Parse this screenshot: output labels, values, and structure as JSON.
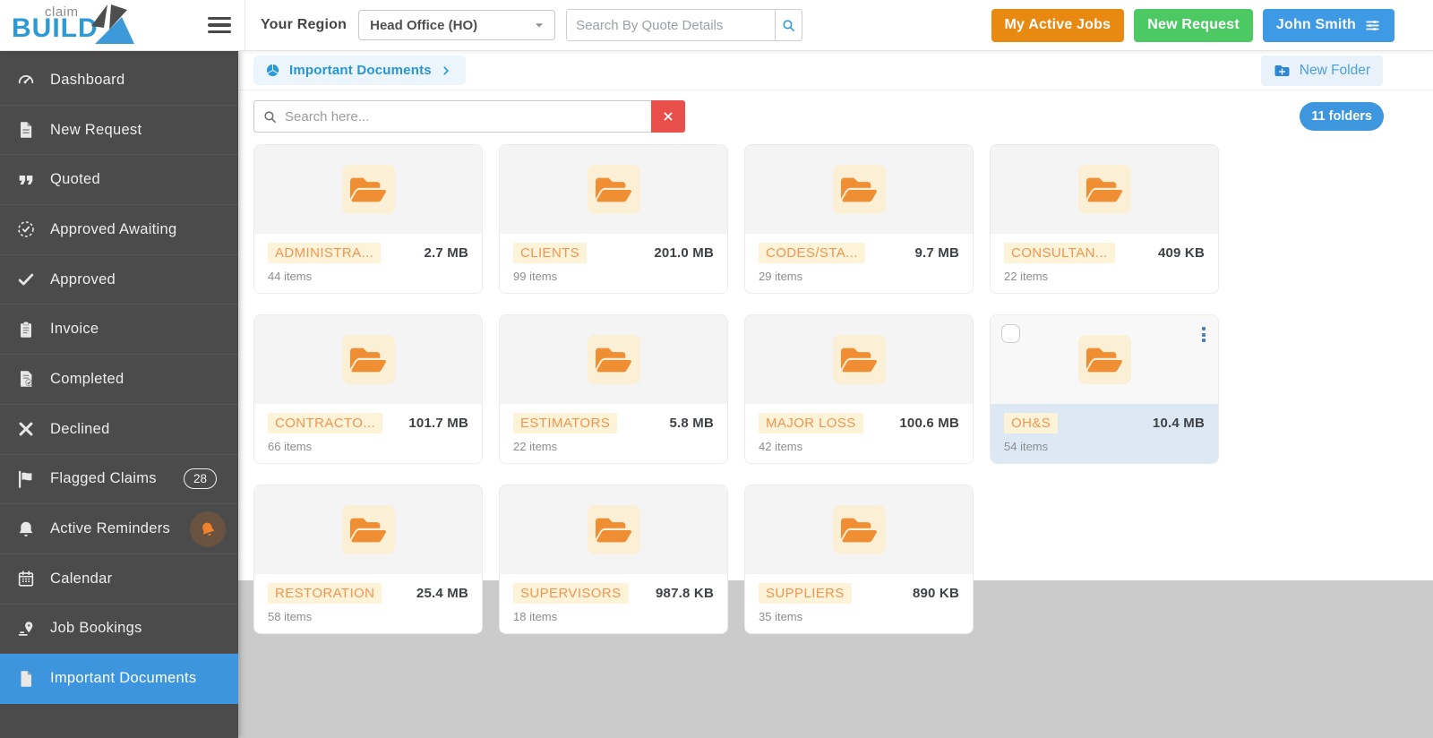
{
  "topbar": {
    "logo_line1": "claim",
    "logo_line2": "BUILD",
    "region_label": "Your Region",
    "region_value": "Head Office (HO)",
    "search_placeholder": "Search By Quote Details",
    "active_jobs_label": "My Active Jobs",
    "new_request_label": "New Request",
    "user_label": "John Smith"
  },
  "sidebar": {
    "items": [
      {
        "label": "Dashboard",
        "icon": "gauge"
      },
      {
        "label": "New Request",
        "icon": "file"
      },
      {
        "label": "Quoted",
        "icon": "quote"
      },
      {
        "label": "Approved Awaiting",
        "icon": "check-circle"
      },
      {
        "label": "Approved",
        "icon": "check"
      },
      {
        "label": "Invoice",
        "icon": "clipboard"
      },
      {
        "label": "Completed",
        "icon": "file-check"
      },
      {
        "label": "Declined",
        "icon": "x"
      },
      {
        "label": "Flagged Claims",
        "icon": "flag",
        "badge": "28"
      },
      {
        "label": "Active Reminders",
        "icon": "bell",
        "indicator": true
      },
      {
        "label": "Calendar",
        "icon": "calendar"
      },
      {
        "label": "Job Bookings",
        "icon": "map-pin"
      },
      {
        "label": "Important Documents",
        "icon": "document",
        "active": true
      }
    ]
  },
  "content": {
    "breadcrumb": "Important Documents",
    "new_folder_label": "New Folder",
    "search_placeholder": "Search here...",
    "folders_count_badge": "11 folders",
    "folders": [
      {
        "name": "ADMINISTRA...",
        "size": "2.7 MB",
        "items": "44 items"
      },
      {
        "name": "CLIENTS",
        "size": "201.0 MB",
        "items": "99 items"
      },
      {
        "name": "CODES/STA...",
        "size": "9.7 MB",
        "items": "29 items"
      },
      {
        "name": "CONSULTAN...",
        "size": "409 KB",
        "items": "22 items"
      },
      {
        "name": "CONTRACTO...",
        "size": "101.7 MB",
        "items": "66 items"
      },
      {
        "name": "ESTIMATORS",
        "size": "5.8 MB",
        "items": "22 items"
      },
      {
        "name": "MAJOR LOSS",
        "size": "100.6 MB",
        "items": "42 items"
      },
      {
        "name": "OH&S",
        "size": "10.4 MB",
        "items": "54 items",
        "selected": true
      },
      {
        "name": "RESTORATION",
        "size": "25.4 MB",
        "items": "58 items"
      },
      {
        "name": "SUPERVISORS",
        "size": "987.8 KB",
        "items": "18 items"
      },
      {
        "name": "SUPPLIERS",
        "size": "890 KB",
        "items": "35 items"
      }
    ]
  },
  "colors": {
    "accent_blue": "#3D96DE",
    "brand_blue": "#2D9AD8",
    "orange": "#E88912",
    "green": "#4DC964",
    "sidebar_bg": "#4B4B4B",
    "folder_orange": "#F08E33",
    "name_highlight": "#FDF3D8",
    "clear_red": "#E94F4B",
    "selected_card_bg": "#DCE9F4"
  }
}
